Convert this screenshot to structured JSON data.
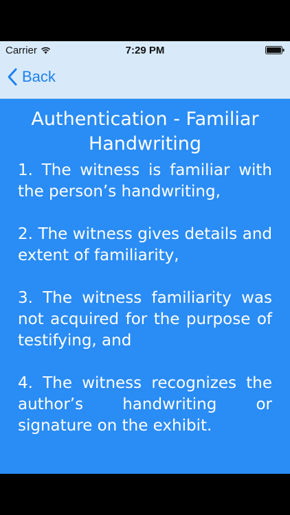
{
  "status_bar": {
    "carrier": "Carrier",
    "time": "7:29 PM",
    "wifi_icon": "wifi-icon",
    "battery_icon": "battery-icon"
  },
  "nav": {
    "back_label": "Back",
    "back_icon": "chevron-left-icon",
    "accent_color": "#1d80f2",
    "bar_color": "#d8eaf9"
  },
  "content": {
    "title_line1": "Authentication - Familiar",
    "title_line2": "Handwriting",
    "background_color": "#2a8cf5",
    "items": [
      "1. The witness is familiar with the person’s handwriting,",
      "2. The witness gives details and extent of familiarity,",
      "3. The witness familiarity was not acquired for the purpose of testifying, and",
      "4. The witness recognizes the author’s handwriting or signature on the exhibit."
    ]
  }
}
